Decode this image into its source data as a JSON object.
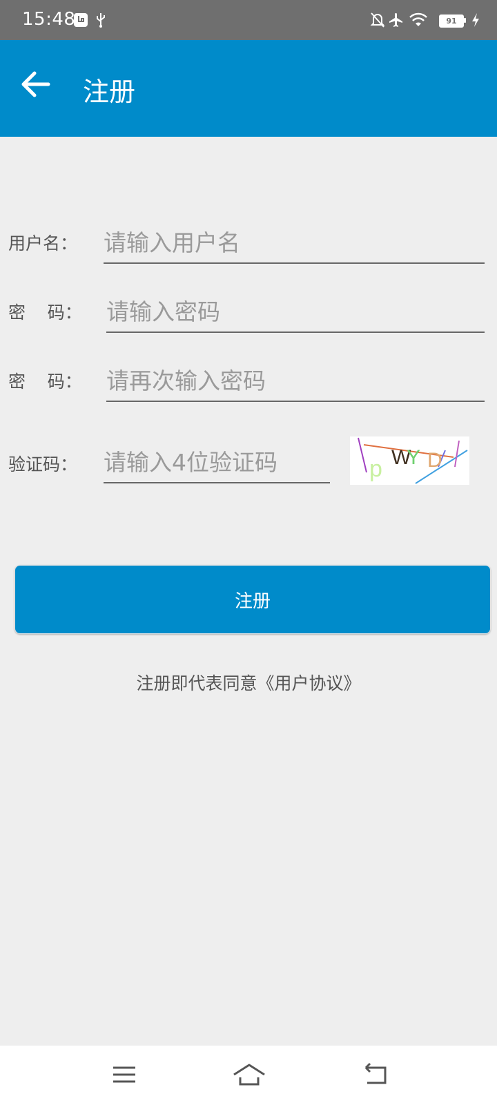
{
  "status_bar": {
    "time": "15:48",
    "battery": "91",
    "icons": [
      "usb-debug-icon",
      "usb-icon",
      "mute-icon",
      "airplane-icon",
      "wifi-icon",
      "battery-icon",
      "charging-icon"
    ]
  },
  "app_bar": {
    "back_icon": "arrow-left-icon",
    "title": "注册"
  },
  "form": {
    "username": {
      "label": "用户名：",
      "placeholder": "请输入用户名",
      "value": ""
    },
    "password": {
      "label": "密    码：",
      "placeholder": "请输入密码",
      "value": ""
    },
    "password_confirm": {
      "label": "密    码：",
      "placeholder": "请再次输入密码",
      "value": ""
    },
    "captcha": {
      "label": "验证码：",
      "placeholder": "请输入4位验证码",
      "value": "",
      "image_text": "pWYD"
    }
  },
  "register_button": "注册",
  "agreement_text": "注册即代表同意《用户协议》",
  "nav_bar": {
    "icons": [
      "menu-icon",
      "home-icon",
      "back-icon"
    ]
  },
  "colors": {
    "primary": "#008bca",
    "status_bar": "#6f6f6f",
    "background": "#eeeeee"
  }
}
